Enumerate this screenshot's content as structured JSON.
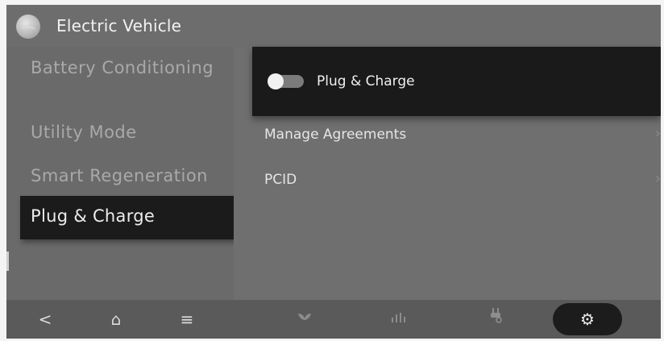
{
  "header": {
    "title": "Electric Vehicle"
  },
  "sidebar": {
    "items": [
      {
        "label": "Battery Conditioning"
      },
      {
        "label": "Utility Mode"
      },
      {
        "label": "Smart Regeneration"
      },
      {
        "label": "Plug & Charge"
      }
    ]
  },
  "content": {
    "toggle": {
      "label": "Plug & Charge",
      "state": "off"
    },
    "rows": [
      {
        "label": "Manage Agreements",
        "chevron": "›"
      },
      {
        "label": "PCID",
        "chevron": "›"
      }
    ]
  },
  "bottombar": {
    "icons": {
      "back": "<",
      "home": "⌂",
      "menu": "≡",
      "eco": "leaf-icon",
      "chart": "chart-icon",
      "plug": "plug-icon",
      "settings": "⚙"
    }
  }
}
